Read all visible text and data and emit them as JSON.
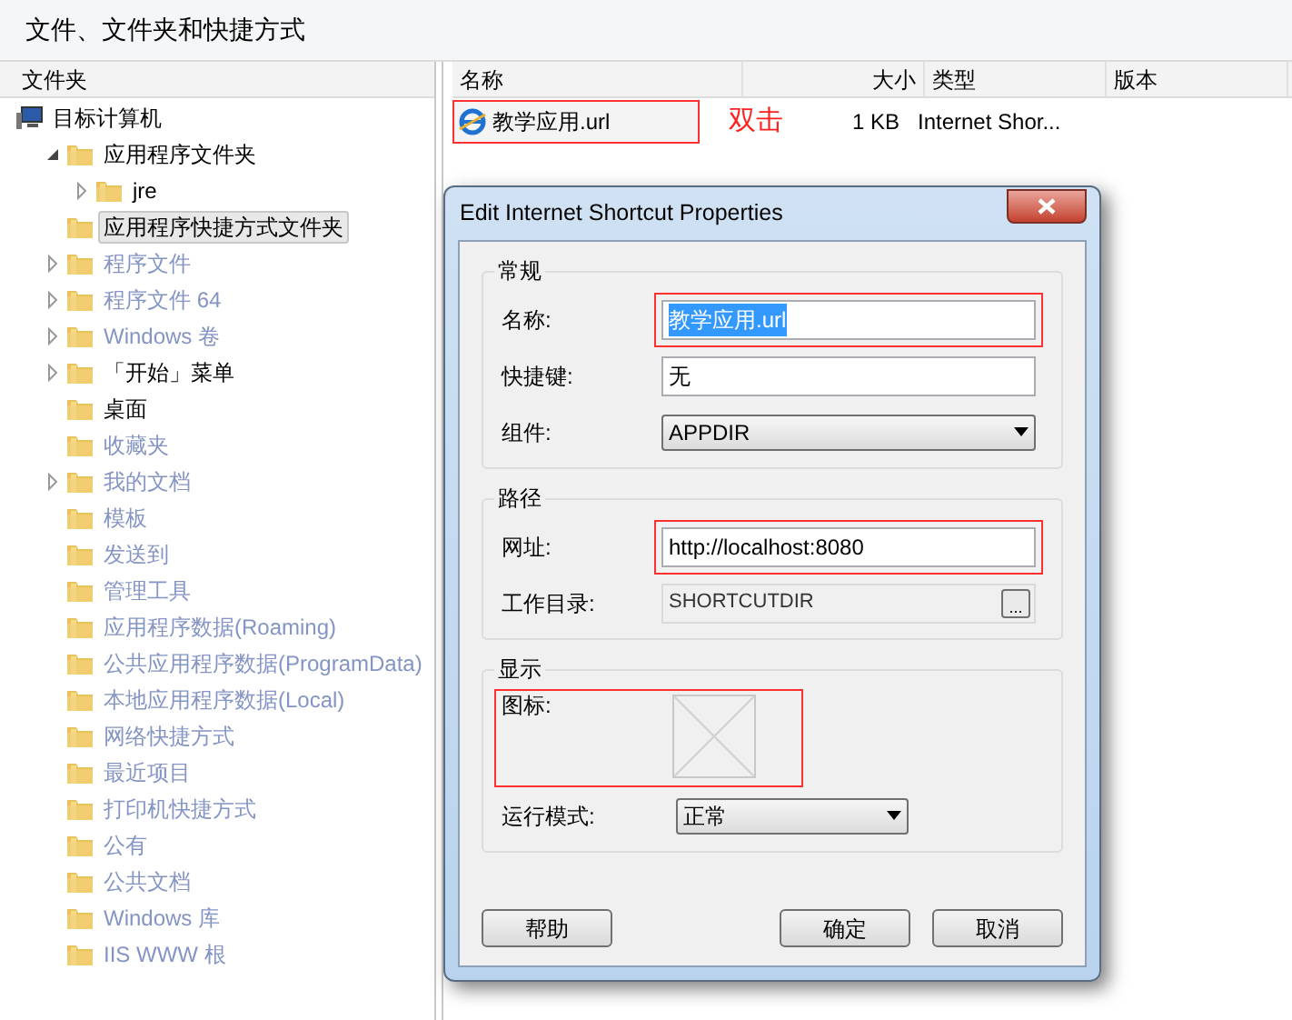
{
  "title": "文件、文件夹和快捷方式",
  "folders": {
    "heading": "文件夹",
    "tree": [
      {
        "label": "目标计算机",
        "dimmed": false,
        "selected": false,
        "children": [
          {
            "label": "应用程序文件夹",
            "expanded": true,
            "dimmed": false,
            "selected": false,
            "children": [
              {
                "label": "jre",
                "expanded": false,
                "dimmed": false,
                "selected": false
              }
            ]
          },
          {
            "label": "应用程序快捷方式文件夹",
            "dimmed": false,
            "selected": true
          },
          {
            "label": "程序文件",
            "expanded": false,
            "dimmed": true,
            "selected": false
          },
          {
            "label": "程序文件 64",
            "expanded": false,
            "dimmed": true,
            "selected": false
          },
          {
            "label": "Windows 卷",
            "expanded": false,
            "dimmed": true,
            "selected": false
          },
          {
            "label": "「开始」菜单",
            "expanded": false,
            "dimmed": false,
            "selected": false
          },
          {
            "label": "桌面",
            "dimmed": false,
            "selected": false
          },
          {
            "label": "收藏夹",
            "dimmed": true,
            "selected": false
          },
          {
            "label": "我的文档",
            "expanded": false,
            "dimmed": true,
            "selected": false
          },
          {
            "label": "模板",
            "dimmed": true,
            "selected": false
          },
          {
            "label": "发送到",
            "dimmed": true,
            "selected": false
          },
          {
            "label": "管理工具",
            "dimmed": true,
            "selected": false
          },
          {
            "label": "应用程序数据(Roaming)",
            "dimmed": true,
            "selected": false
          },
          {
            "label": "公共应用程序数据(ProgramData)",
            "dimmed": true,
            "selected": false
          },
          {
            "label": "本地应用程序数据(Local)",
            "dimmed": true,
            "selected": false
          },
          {
            "label": "网络快捷方式",
            "dimmed": true,
            "selected": false
          },
          {
            "label": "最近项目",
            "dimmed": true,
            "selected": false
          },
          {
            "label": "打印机快捷方式",
            "dimmed": true,
            "selected": false
          },
          {
            "label": "公有",
            "dimmed": true,
            "selected": false
          },
          {
            "label": "公共文档",
            "dimmed": true,
            "selected": false
          },
          {
            "label": "Windows 库",
            "dimmed": true,
            "selected": false
          },
          {
            "label": "IIS WWW 根",
            "dimmed": true,
            "selected": false
          }
        ]
      }
    ]
  },
  "files": {
    "columns": [
      "名称",
      "大小",
      "类型",
      "版本"
    ],
    "rows": [
      {
        "name": "教学应用.url",
        "size": "1 KB",
        "type": "Internet Shor...",
        "highlighted": true,
        "annotation": "双击"
      }
    ]
  },
  "dialog": {
    "title": "Edit Internet Shortcut Properties",
    "groups": [
      {
        "title": "常规",
        "fields": [
          {
            "kind": "text",
            "label": "名称:",
            "value": "教学应用.url",
            "text_selected": true,
            "highlighted": true
          },
          {
            "kind": "text",
            "label": "快捷键:",
            "value": "无",
            "text_selected": false,
            "highlighted": false
          },
          {
            "kind": "dropdown",
            "label": "组件:",
            "value": "APPDIR",
            "highlighted": false
          }
        ]
      },
      {
        "title": "路径",
        "fields": [
          {
            "kind": "text",
            "label": "网址:",
            "value": "http://localhost:8080",
            "text_selected": false,
            "highlighted": true
          },
          {
            "kind": "browse",
            "label": "工作目录:",
            "value": "SHORTCUTDIR",
            "button": "...",
            "highlighted": false
          }
        ]
      },
      {
        "title": "显示",
        "fields": [
          {
            "kind": "icon",
            "label": "图标:",
            "highlighted": true
          },
          {
            "kind": "short_dropdown",
            "label": "运行模式:",
            "value": "正常",
            "highlighted": false
          }
        ]
      }
    ],
    "buttons": [
      {
        "label": "帮助",
        "kind": "left"
      },
      {
        "label": "确定",
        "kind": "right"
      },
      {
        "label": "取消",
        "kind": "right"
      }
    ]
  }
}
